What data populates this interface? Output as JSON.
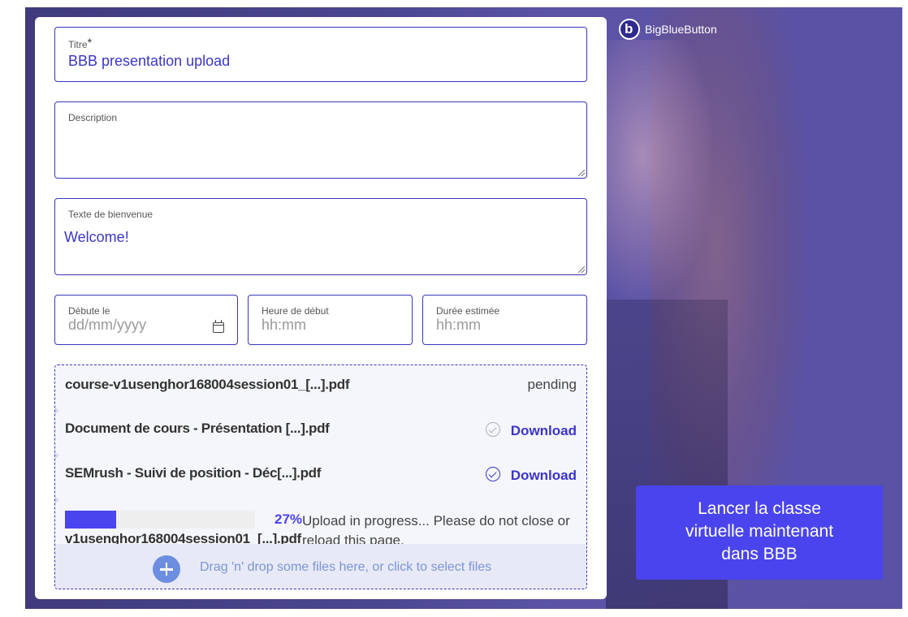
{
  "brand": {
    "name": "BigBlueButton",
    "logo_letter": "b"
  },
  "form": {
    "title_label": "Titre",
    "title_required": "*",
    "title_value": "BBB presentation upload",
    "description_label": "Description",
    "description_value": "",
    "welcome_label": "Texte de bienvenue",
    "welcome_value": "Welcome!",
    "start_date_label": "Débute le",
    "start_date_placeholder": "dd/mm/yyyy",
    "start_time_label": "Heure de début",
    "start_time_placeholder": "hh:mm",
    "duration_label": "Durée estimée",
    "duration_placeholder": "hh:mm"
  },
  "files": [
    {
      "name": "course-v1usenghor168004session01_[...].pdf",
      "status": "pending"
    },
    {
      "name": "Document de cours - Présentation [...].pdf",
      "action": "Download",
      "check": "grey"
    },
    {
      "name": "SEMrush - Suivi de position - Déc[...].pdf",
      "action": "Download",
      "check": "blue"
    }
  ],
  "upload": {
    "name": "v1usenghor168004session01_[...].pdf",
    "percent": 27,
    "percent_label": "27%",
    "message": "Upload in progress... Please do not close or reload this page."
  },
  "dropzone": {
    "text": "Drag 'n' drop some files here, or click to select files",
    "icon": "plus-circle-icon"
  },
  "launch_button": {
    "line1": "Lancer la classe",
    "line2": "virtuelle maintenant",
    "line3": "dans BBB"
  },
  "colors": {
    "accent": "#4a44ee",
    "field_border": "#3b35b8",
    "link": "#3b35c9",
    "hero_overlay": "#4b4690"
  }
}
